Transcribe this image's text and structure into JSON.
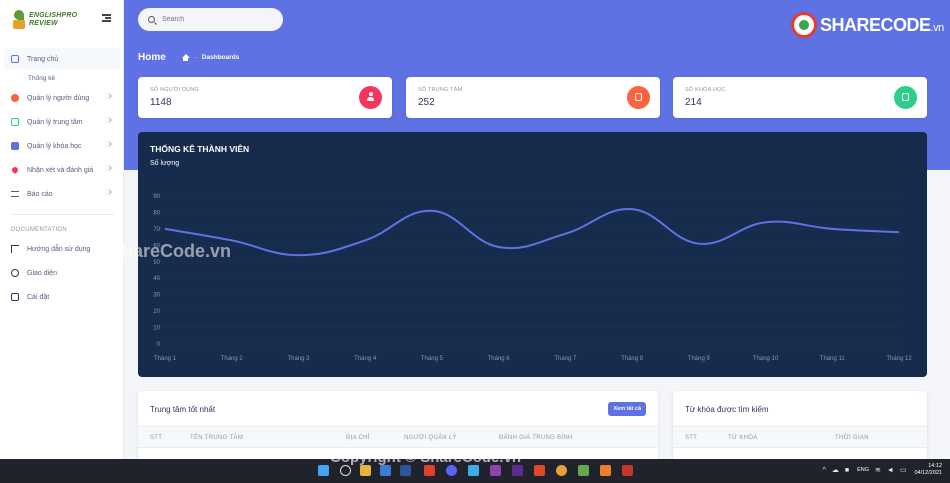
{
  "sidebar": {
    "logo_line1": "ENGLISHPRO",
    "logo_line2": "REVIEW",
    "items": [
      {
        "label": "Trang chủ",
        "icon": "monitor-icon",
        "color": "#5e72e4"
      },
      {
        "label": "Quản lý người dùng",
        "icon": "user-icon",
        "color": "#fb6340"
      },
      {
        "label": "Quản lý trung tâm",
        "icon": "building-icon",
        "color": "#2dce89"
      },
      {
        "label": "Quản lý khóa học",
        "icon": "book-icon",
        "color": "#5e72e4"
      },
      {
        "label": "Nhận xét và đánh giá",
        "icon": "heart-icon",
        "color": "#f5365c"
      },
      {
        "label": "Báo cáo",
        "icon": "list-icon",
        "color": "#525f7f"
      }
    ],
    "sub_item": "Thống kê",
    "section_heading": "DOCUMENTATION",
    "doc_items": [
      {
        "label": "Hướng dẫn sử dụng",
        "icon": "music-note-icon"
      },
      {
        "label": "Giao diện",
        "icon": "palette-icon"
      },
      {
        "label": "Cài đặt",
        "icon": "settings-icon"
      }
    ]
  },
  "header": {
    "search_placeholder": "Search",
    "brand_main": "SHARECODE",
    "brand_ext": ".vn",
    "breadcrumb_title": "Home",
    "breadcrumb_sep": "-",
    "breadcrumb_item": "Dashboards"
  },
  "stats": [
    {
      "label": "Số người dùng",
      "value": "1148",
      "color": "#f5365c",
      "icon": "user-icon"
    },
    {
      "label": "Số trung tâm",
      "value": "252",
      "color": "#fb6340",
      "icon": "building-icon"
    },
    {
      "label": "Số khóa học",
      "value": "214",
      "color": "#2dce89",
      "icon": "book-icon"
    }
  ],
  "chart_data": {
    "type": "line",
    "title": "THỐNG KÊ THÀNH VIÊN",
    "ylabel": "Số lượng",
    "categories": [
      "Tháng 1",
      "Tháng 2",
      "Tháng 3",
      "Tháng 4",
      "Tháng 5",
      "Tháng 6",
      "Tháng 7",
      "Tháng 8",
      "Tháng 9",
      "Tháng 10",
      "Tháng 11",
      "Tháng 12"
    ],
    "series": [
      {
        "values": [
          70,
          63,
          54,
          63,
          81,
          59,
          67,
          82,
          61,
          74,
          70,
          68
        ],
        "color": "#5e72e4"
      }
    ],
    "ylim": [
      0,
      90
    ],
    "yticks": [
      0,
      10,
      20,
      30,
      40,
      50,
      60,
      70,
      80,
      90
    ],
    "grid": true
  },
  "best_centers": {
    "title": "Trung tâm tốt nhất",
    "see_all": "Xem tất cả",
    "columns": [
      "STT",
      "TÊN TRUNG TÂM",
      "ĐỊA CHỈ",
      "NGƯỜI QUẢN LÝ",
      "ĐÁNH GIÁ TRUNG BÌNH"
    ]
  },
  "search_keywords": {
    "title": "Từ khóa được tìm kiếm",
    "columns": [
      "STT",
      "TỪ KHÓA",
      "THỜI GIAN"
    ]
  },
  "taskbar": {
    "lang": "ENG",
    "time": "14:12",
    "date": "04/12/2021"
  },
  "watermarks": {
    "center": "ShareCode.vn",
    "bottom": "Copyright © ShareCode.vn"
  }
}
